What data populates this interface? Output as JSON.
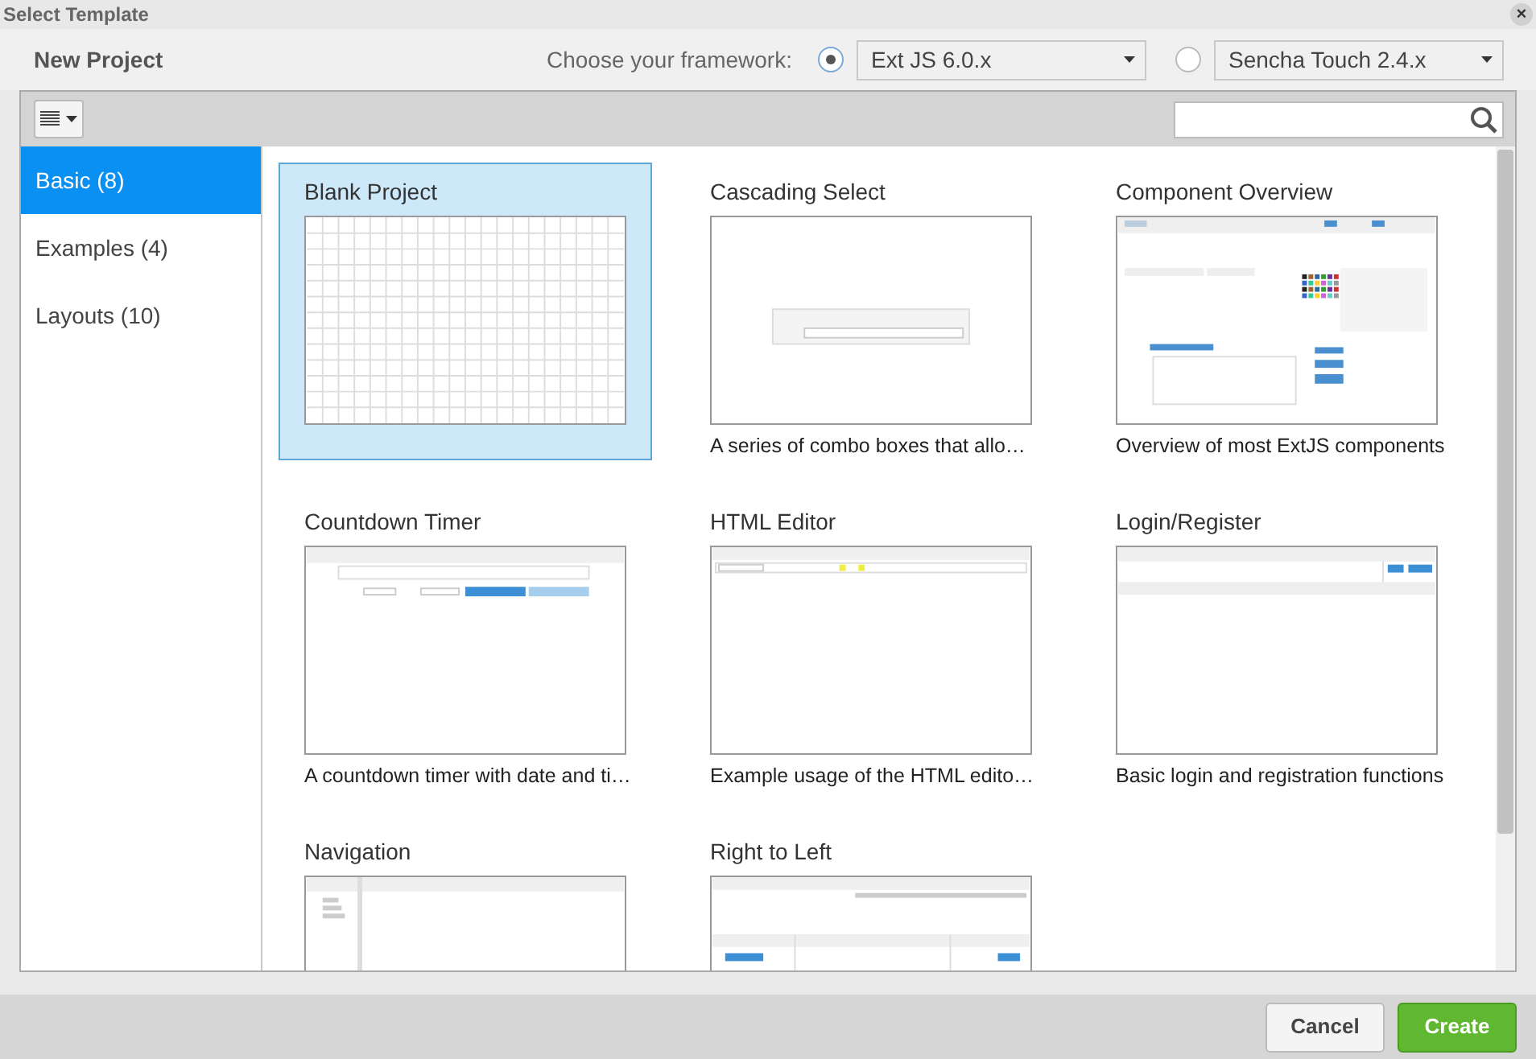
{
  "window": {
    "title": "Select Template",
    "close": "×"
  },
  "header": {
    "title": "New Project",
    "framework_label": "Choose your framework:",
    "frameworks": [
      {
        "label": "Ext JS 6.0.x",
        "selected": true
      },
      {
        "label": "Sencha Touch 2.4.x",
        "selected": false
      }
    ]
  },
  "sidebar": {
    "items": [
      {
        "label": "Basic (8)",
        "selected": true
      },
      {
        "label": "Examples (4)",
        "selected": false
      },
      {
        "label": "Layouts (10)",
        "selected": false
      }
    ]
  },
  "templates": [
    {
      "title": "Blank Project",
      "kind": "grid",
      "selected": true
    },
    {
      "title": "Cascading Select",
      "description": "A series of combo boxes that allo…",
      "kind": "combo",
      "selected": false
    },
    {
      "title": "Component Overview",
      "description": "Overview of most ExtJS components",
      "kind": "overview",
      "selected": false
    },
    {
      "title": "Countdown Timer",
      "description": "A countdown timer with date and ti…",
      "kind": "timer",
      "selected": false
    },
    {
      "title": "HTML Editor",
      "description": "Example usage of the HTML edito…",
      "kind": "editor",
      "selected": false
    },
    {
      "title": "Login/Register",
      "description": "Basic login and registration functions",
      "kind": "login",
      "selected": false
    },
    {
      "title": "Navigation",
      "kind": "navigation",
      "selected": false
    },
    {
      "title": "Right to Left",
      "kind": "rtl",
      "selected": false
    }
  ],
  "buttons": [
    {
      "label": "Cancel",
      "kind": "secondary"
    },
    {
      "label": "Create",
      "kind": "primary"
    }
  ]
}
